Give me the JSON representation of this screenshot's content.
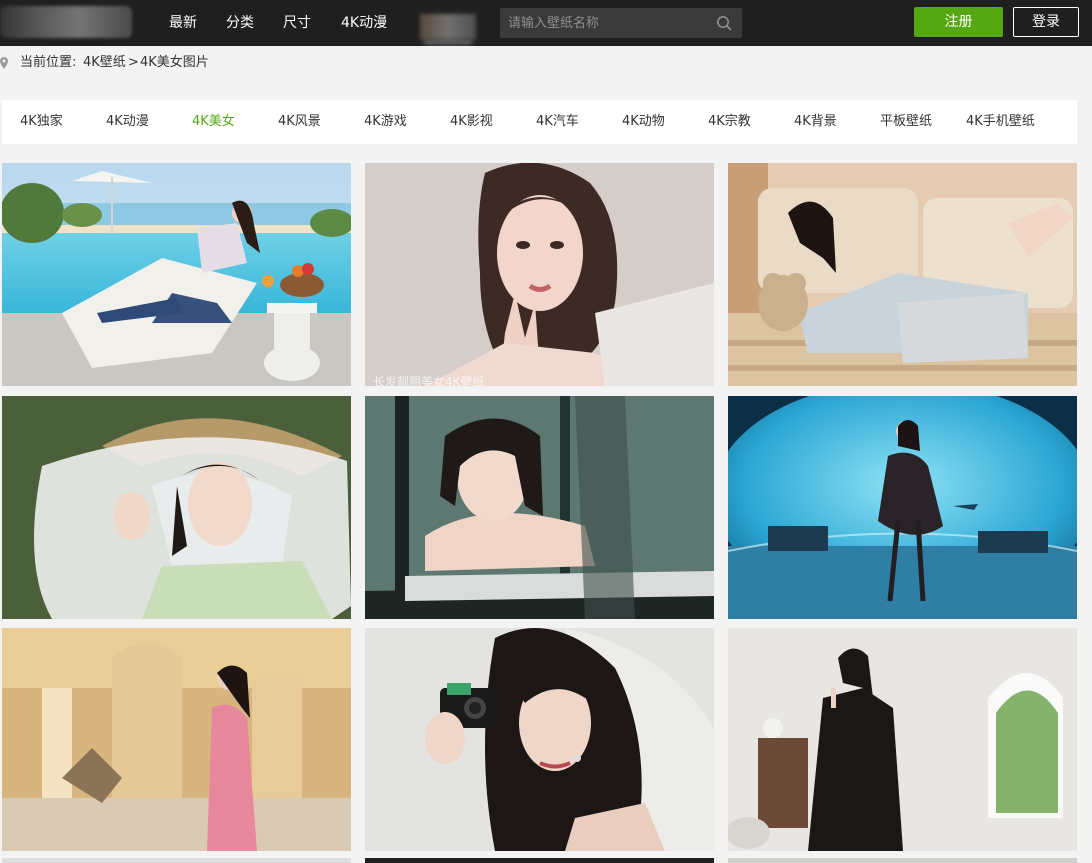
{
  "header": {
    "nav": [
      "最新",
      "分类",
      "尺寸",
      "4K动漫"
    ],
    "search_placeholder": "请输入壁纸名称",
    "register_label": "注册",
    "login_label": "登录"
  },
  "breadcrumb": {
    "prefix": "当前位置:",
    "items": [
      "4K壁纸",
      "4K美女图片"
    ],
    "separator": ">"
  },
  "categories": {
    "items": [
      "4K独家",
      "4K动漫",
      "4K美女",
      "4K风景",
      "4K游戏",
      "4K影视",
      "4K汽车",
      "4K动物",
      "4K宗教",
      "4K背景",
      "平板壁纸",
      "4K手机壁纸"
    ],
    "active": "4K美女"
  },
  "gallery": {
    "tiles": [
      {
        "name": "poolside-lounge"
      },
      {
        "name": "studio-portrait",
        "caption": "长发靓丽美女4K壁纸"
      },
      {
        "name": "sofa-teddy-bear"
      },
      {
        "name": "white-veil-hat"
      },
      {
        "name": "window-reflection"
      },
      {
        "name": "aquarium-dress"
      },
      {
        "name": "palace-pink-dress"
      },
      {
        "name": "camera-portrait"
      },
      {
        "name": "black-dress-arch"
      }
    ]
  },
  "colors": {
    "accent": "#56a813",
    "topbar": "#1f1f1f",
    "page_bg": "#f3f3f3"
  }
}
